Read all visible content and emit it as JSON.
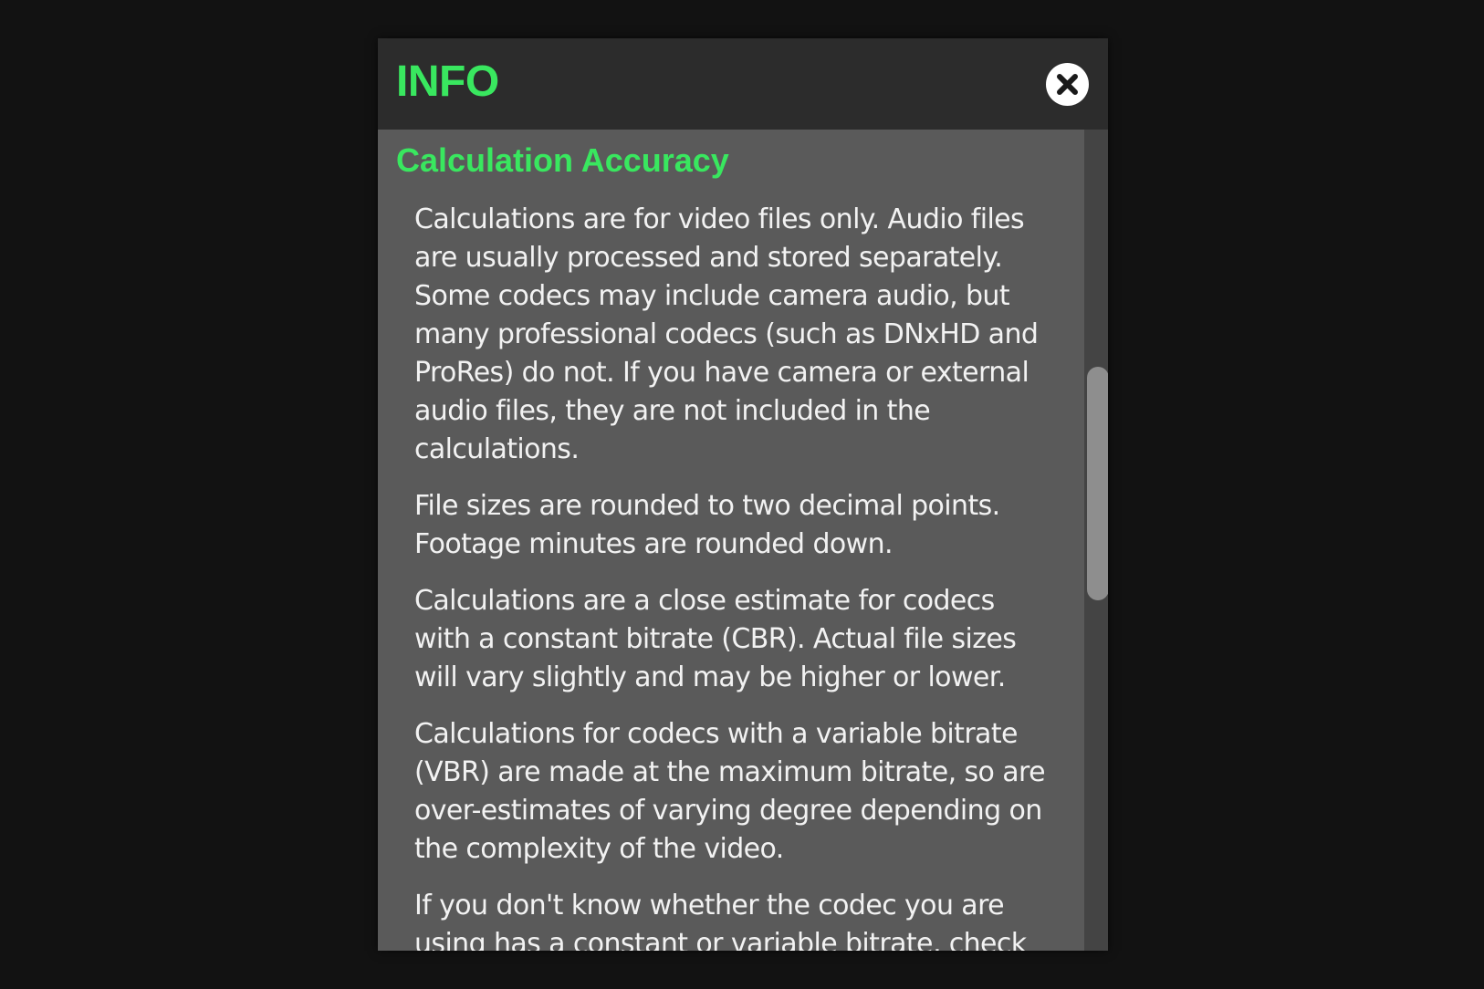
{
  "modal": {
    "title": "INFO",
    "close_icon": "close-x-icon"
  },
  "section": {
    "title": "Calculation Accuracy",
    "paragraphs": [
      {
        "lines": [
          "Calculations are for video files only. Audio files",
          "are usually processed and stored separately.",
          "Some codecs may include camera audio, but",
          "many professional codecs (such as DNxHD and",
          "ProRes) do not. If you have camera or external",
          "audio files, they are not included in the",
          "calculations."
        ]
      },
      {
        "lines": [
          "File sizes are rounded to two decimal points.",
          "Footage minutes are rounded down."
        ]
      },
      {
        "lines": [
          "Calculations are a close estimate for codecs",
          "with a constant bitrate (CBR). Actual file sizes",
          "will vary slightly and may be higher or lower."
        ]
      },
      {
        "lines": [
          "Calculations for codecs with a variable bitrate",
          "(VBR) are made at the maximum bitrate, so are",
          "over-estimates of varying degree depending on",
          "the complexity of the video."
        ]
      },
      {
        "lines": [
          "If you don't know whether the codec you are",
          "using has a constant or variable bitrate, check"
        ]
      }
    ]
  },
  "colors": {
    "accent": "#39e75f",
    "header_bg": "#2c2c2c",
    "body_bg": "#5a5a5a",
    "text": "#f2f2f2",
    "scroll_thumb": "#8e8e8e"
  }
}
